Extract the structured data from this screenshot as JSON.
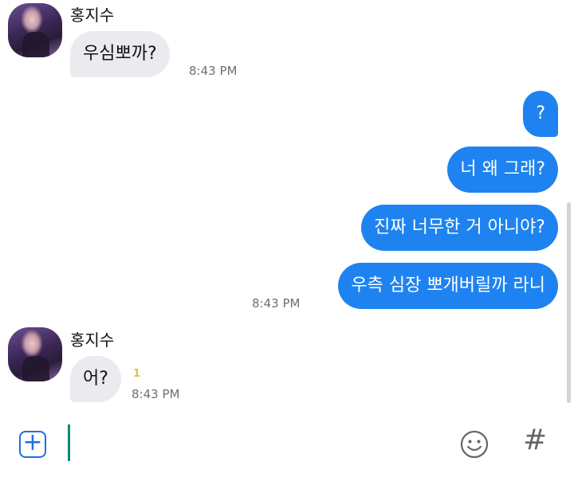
{
  "messages": [
    {
      "sender": "홍지수",
      "direction": "incoming",
      "text": "우심뽀까?",
      "time": "8:43 PM"
    },
    {
      "direction": "outgoing",
      "text": "?"
    },
    {
      "direction": "outgoing",
      "text": "너 왜 그래?"
    },
    {
      "direction": "outgoing",
      "text": "진짜 너무한 거 아니야?"
    },
    {
      "direction": "outgoing",
      "text": "우측 심장 뽀개버릴까 라니",
      "time": "8:43 PM"
    },
    {
      "sender": "홍지수",
      "direction": "incoming",
      "text": "어?",
      "unread": "1",
      "time": "8:43 PM"
    }
  ],
  "composer": {
    "attach_icon": "plus-square-icon",
    "emoji_icon": "smiley-icon",
    "hashtag_label": "#",
    "input_value": ""
  },
  "colors": {
    "outgoing_bubble": "#1e83f0",
    "incoming_bubble": "#ebebef",
    "accent": "#1e6fe0",
    "cursor": "#0a8a7a",
    "unread": "#e0c04a"
  }
}
